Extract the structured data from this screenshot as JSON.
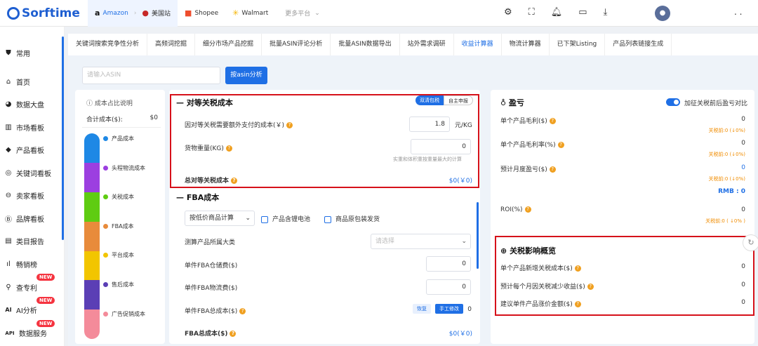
{
  "brand": {
    "name": "Sorftime"
  },
  "header": {
    "platforms": [
      {
        "label": "Amazon",
        "icon": "amazon-icon"
      },
      {
        "label": "美国站",
        "icon": "us-flag-icon"
      },
      {
        "label": "Shopee",
        "icon": "shopee-icon"
      },
      {
        "label": "Walmart",
        "icon": "walmart-icon"
      }
    ],
    "more_platforms": "更多平台",
    "icons": [
      "settings-icon",
      "fullscreen-icon",
      "bell-icon",
      "folder-icon",
      "download-icon"
    ],
    "more": ". ."
  },
  "sidebar": {
    "items": [
      {
        "label": "常用",
        "icon": "shield-icon"
      },
      {
        "label": "首页",
        "icon": "home-icon"
      },
      {
        "label": "数据大盘",
        "icon": "pie-icon"
      },
      {
        "label": "市场看板",
        "icon": "market-icon"
      },
      {
        "label": "产品看板",
        "icon": "box-icon"
      },
      {
        "label": "关键词看板",
        "icon": "keyword-icon"
      },
      {
        "label": "卖家看板",
        "icon": "seller-icon"
      },
      {
        "label": "品牌看板",
        "icon": "brand-icon"
      },
      {
        "label": "类目报告",
        "icon": "report-icon"
      },
      {
        "label": "畅销榜",
        "icon": "rank-icon"
      },
      {
        "label": "查专利",
        "icon": "patent-icon",
        "badge": "NEW"
      },
      {
        "label": "AI分析",
        "icon": "ai-icon",
        "badge": "NEW"
      },
      {
        "label": "数据服务",
        "icon": "api-icon",
        "badge": "NEW"
      }
    ]
  },
  "tabs": [
    "关键词搜索竞争性分析",
    "高频词挖掘",
    "细分市场产品挖掘",
    "批量ASIN评论分析",
    "批量ASIN数据导出",
    "站外需求调研",
    "收益计算器",
    "物流计算器",
    "已下架Listing",
    "产品列表链接生成"
  ],
  "active_tab": "收益计算器",
  "search": {
    "placeholder": "请输入ASIN",
    "button": "按asin分析"
  },
  "cost_panel": {
    "title": "成本占比说明",
    "total_label": "合计成本($):",
    "total_value": "$0",
    "legend": [
      {
        "label": "产品成本",
        "color": "#1e88e5"
      },
      {
        "label": "头程物流成本",
        "color": "#9c3fe0"
      },
      {
        "label": "关税成本",
        "color": "#5fcc12"
      },
      {
        "label": "FBA成本",
        "color": "#e88b3b"
      },
      {
        "label": "平台成本",
        "color": "#f2c500"
      },
      {
        "label": "售后成本",
        "color": "#5b3fb5"
      },
      {
        "label": "广告促销成本",
        "color": "#f48b9a"
      }
    ]
  },
  "tariff": {
    "title": "对等关税成本",
    "mode_buttons": [
      "双清包税",
      "自主申报"
    ],
    "cost_label": "因对等关税需要额外支付的成本(￥)",
    "cost_value": "1.8",
    "cost_unit": "元/KG",
    "weight_label": "货物重量(KG)",
    "weight_value": "0",
    "weight_hint": "实重和体积重按重量最大的计算",
    "total_label": "总对等关税成本",
    "total_value": "$0(￥0)"
  },
  "fba": {
    "title": "FBA成本",
    "calc_select": "按低价商品计算",
    "battery": "产品含锂电池",
    "original_pack": "商品原包装发货",
    "category_label": "测算产品所属大类",
    "category_placeholder": "请选择",
    "storage_label": "单件FBA仓储费($)",
    "storage_value": "0",
    "logistics_label": "单件FBA物流费($)",
    "logistics_value": "0",
    "total_single_label": "单件FBA总成本($)",
    "restore_button": "恢复",
    "manual_button": "手工修改",
    "total_single_value": "0",
    "total_label": "FBA总成本($)",
    "total_value": "$0(￥0)"
  },
  "profit": {
    "title": "盈亏",
    "toggle_label": "加征关税前后盈亏对比",
    "rows": [
      {
        "label": "单个产品毛利($)",
        "value": "0",
        "sub": "关税前:0 (↓0%)"
      },
      {
        "label": "单个产品毛利率(%)",
        "value": "0",
        "sub": "关税前:0 (↓0%)"
      },
      {
        "label": "预计月度盈亏($)",
        "value": "0",
        "sub": "关税前:0 (↓0%)",
        "rmb": "RMB : 0"
      },
      {
        "label": "ROI(%)",
        "value": "0",
        "sub": "关税前:0 ( ↓0% )"
      }
    ]
  },
  "impact": {
    "title": "关税影响概览",
    "rows": [
      {
        "label": "单个产品新增关税成本($)",
        "value": "0"
      },
      {
        "label": "预计每个月因关税减少收益($)",
        "value": "0"
      },
      {
        "label": "建议单件产品涨价金额($)",
        "value": "0"
      }
    ]
  }
}
